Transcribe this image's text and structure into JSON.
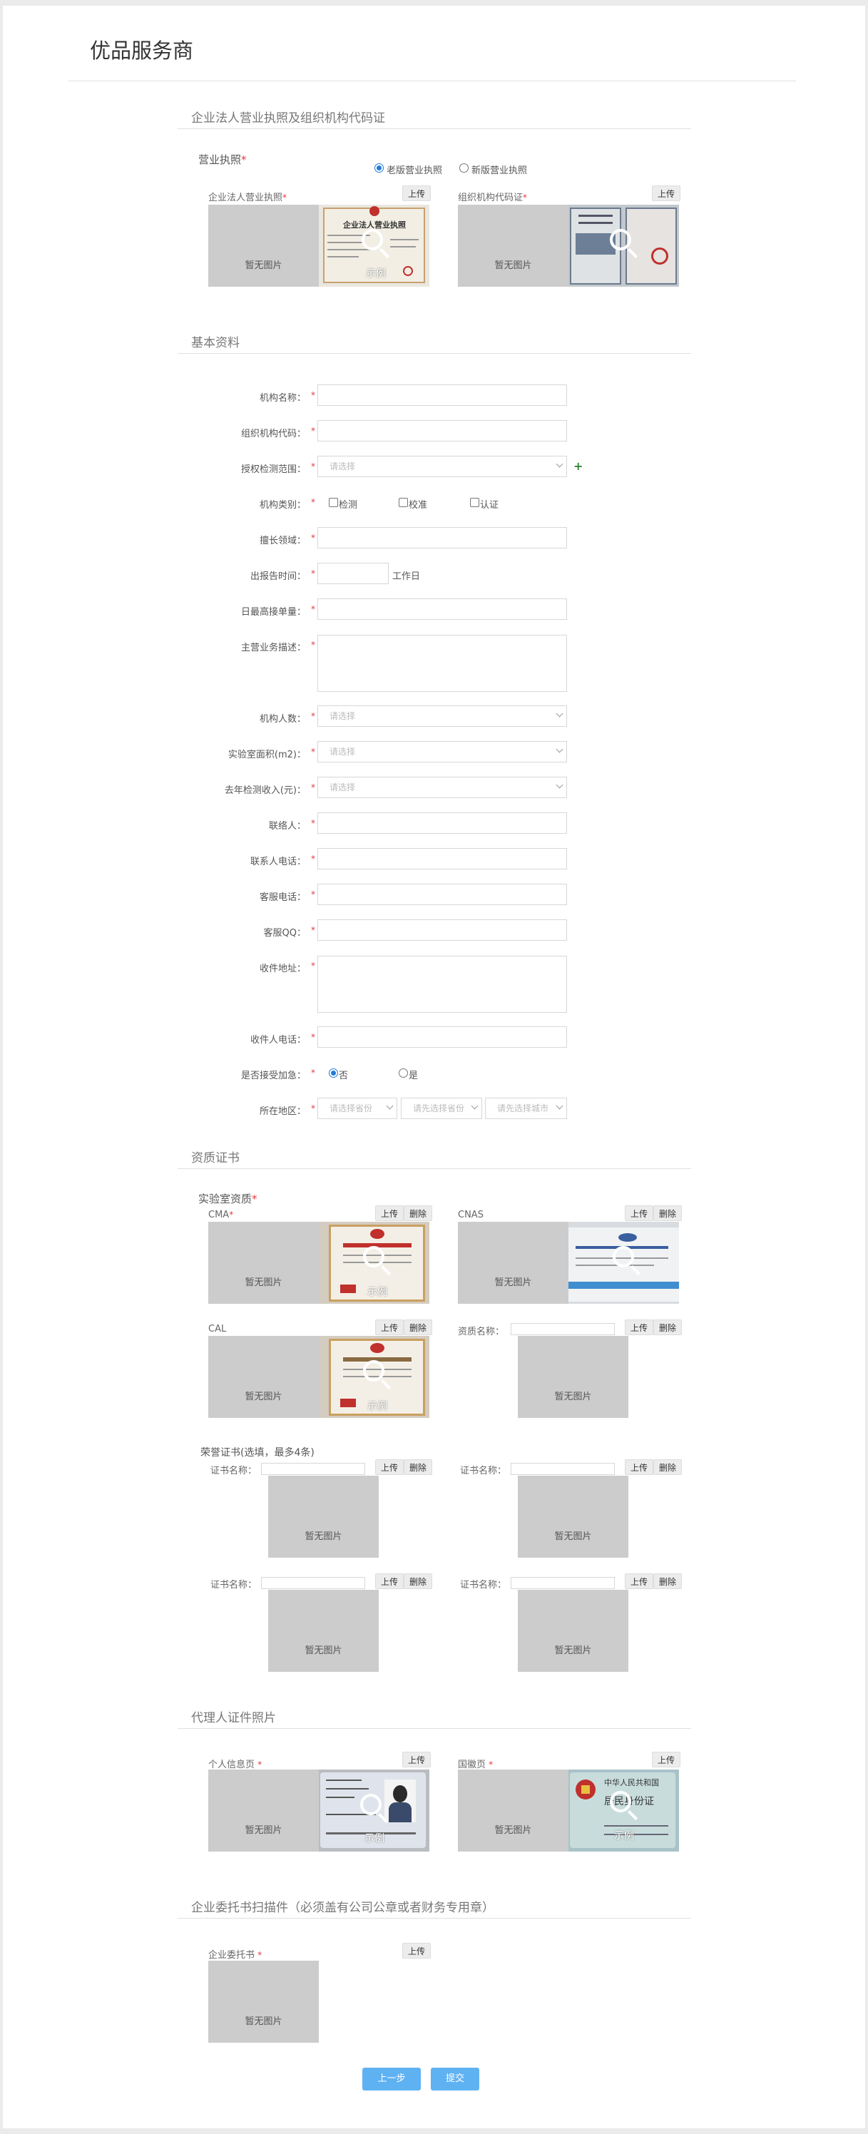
{
  "page_title": "优品服务商",
  "common": {
    "upload": "上传",
    "delete": "删除",
    "no_image": "暂无图片",
    "sample": "示例",
    "required": "*"
  },
  "license_section": {
    "title": "企业法人营业执照及组织机构代码证",
    "label": "营业执照",
    "options": [
      "老版营业执照",
      "新版营业执照"
    ],
    "selected_option": "老版营业执照",
    "cards": [
      {
        "label": "企业法人营业执照",
        "sample_caption": "企业法人营业执照"
      },
      {
        "label": "组织机构代码证"
      }
    ]
  },
  "basic_section": {
    "title": "基本资料",
    "fields": [
      {
        "label": "机构名称：",
        "type": "input"
      },
      {
        "label": "组织机构代码：",
        "type": "input"
      },
      {
        "label": "授权检测范围：",
        "type": "select",
        "placeholder": "请选择",
        "extra": "+"
      },
      {
        "label": "机构类别：",
        "type": "checkbox",
        "options": [
          "检测",
          "校准",
          "认证"
        ]
      },
      {
        "label": "擅长领域：",
        "type": "input"
      },
      {
        "label": "出报告时间：",
        "type": "short-input",
        "suffix": "工作日"
      },
      {
        "label": "日最高接单量：",
        "type": "input"
      },
      {
        "label": "主营业务描述：",
        "type": "textarea"
      },
      {
        "label": "机构人数：",
        "type": "select",
        "placeholder": "请选择"
      },
      {
        "label": "实验室面积(m2)：",
        "type": "select",
        "placeholder": "请选择"
      },
      {
        "label": "去年检测收入(元)：",
        "type": "select",
        "placeholder": "请选择"
      },
      {
        "label": "联络人：",
        "type": "input"
      },
      {
        "label": "联系人电话：",
        "type": "input"
      },
      {
        "label": "客服电话：",
        "type": "input"
      },
      {
        "label": "客服QQ：",
        "type": "input"
      },
      {
        "label": "收件地址：",
        "type": "textarea"
      },
      {
        "label": "收件人电话：",
        "type": "input"
      },
      {
        "label": "是否接受加急：",
        "type": "radio",
        "options": [
          "否",
          "是"
        ],
        "selected": "否"
      },
      {
        "label": "所在地区：",
        "type": "region",
        "placeholders": [
          "请选择省份",
          "请先选择省份",
          "请先选择城市"
        ]
      }
    ]
  },
  "qualification_section": {
    "title": "资质证书",
    "lab_label": "实验室资质",
    "cma_label": "CMA",
    "cnas_label": "CNAS",
    "cal_label": "CAL",
    "qual_name_label": "资质名称：",
    "honor_label": "荣誉证书(选填，最多4条)",
    "cert_name_label": "证书名称："
  },
  "agent_section": {
    "title": "代理人证件照片",
    "info_page_label": "个人信息页",
    "emblem_page_label": "国徽页",
    "id_title": "中华人民共和国",
    "id_subtitle": "居民身份证"
  },
  "entrust_section": {
    "title": "企业委托书扫描件（必须盖有公司公章或者财务专用章）",
    "label": "企业委托书"
  },
  "actions": {
    "prev": "上一步",
    "submit": "提交"
  }
}
